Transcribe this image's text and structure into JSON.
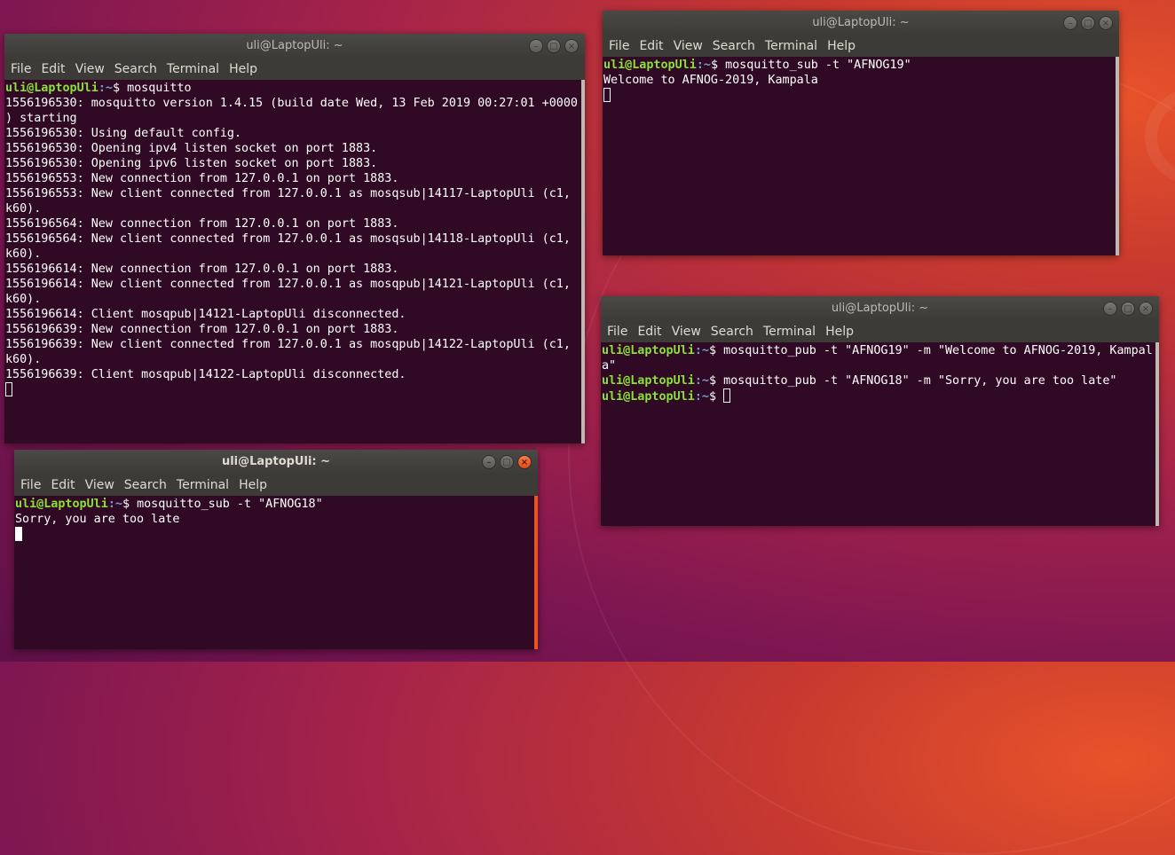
{
  "prompt": {
    "user": "uli@LaptopUli",
    "path": ":~",
    "symbol": "$ "
  },
  "windows": {
    "broker": {
      "title": "uli@LaptopUli: ~",
      "menu": [
        "File",
        "Edit",
        "View",
        "Search",
        "Terminal",
        "Help"
      ],
      "command": "mosquitto",
      "output": [
        "1556196530: mosquitto version 1.4.15 (build date Wed, 13 Feb 2019 00:27:01 +0000",
        ") starting",
        "1556196530: Using default config.",
        "1556196530: Opening ipv4 listen socket on port 1883.",
        "1556196530: Opening ipv6 listen socket on port 1883.",
        "1556196553: New connection from 127.0.0.1 on port 1883.",
        "1556196553: New client connected from 127.0.0.1 as mosqsub|14117-LaptopUli (c1,",
        "k60).",
        "1556196564: New connection from 127.0.0.1 on port 1883.",
        "1556196564: New client connected from 127.0.0.1 as mosqsub|14118-LaptopUli (c1,",
        "k60).",
        "1556196614: New connection from 127.0.0.1 on port 1883.",
        "1556196614: New client connected from 127.0.0.1 as mosqpub|14121-LaptopUli (c1,",
        "k60).",
        "1556196614: Client mosqpub|14121-LaptopUli disconnected.",
        "1556196639: New connection from 127.0.0.1 on port 1883.",
        "1556196639: New client connected from 127.0.0.1 as mosqpub|14122-LaptopUli (c1,",
        "k60).",
        "1556196639: Client mosqpub|14122-LaptopUli disconnected."
      ]
    },
    "sub19": {
      "title": "uli@LaptopUli: ~",
      "menu": [
        "File",
        "Edit",
        "View",
        "Search",
        "Terminal",
        "Help"
      ],
      "command": "mosquitto_sub -t \"AFNOG19\"",
      "output": [
        "Welcome to AFNOG-2019, Kampala"
      ]
    },
    "pub": {
      "title": "uli@LaptopUli: ~",
      "menu": [
        "File",
        "Edit",
        "View",
        "Search",
        "Terminal",
        "Help"
      ],
      "command1": "mosquitto_pub -t \"AFNOG19\" -m \"Welcome to AFNOG-2019, Kampal",
      "command1_wrap": "a\"",
      "command2": "mosquitto_pub -t \"AFNOG18\" -m \"Sorry, you are too late\""
    },
    "sub18": {
      "title": "uli@LaptopUli: ~",
      "menu": [
        "File",
        "Edit",
        "View",
        "Search",
        "Terminal",
        "Help"
      ],
      "command": "mosquitto_sub -t \"AFNOG18\"",
      "output": [
        "Sorry, you are too late"
      ]
    }
  },
  "colors": {
    "terminal_bg": "#300a24",
    "prompt_user": "#8ae234",
    "prompt_path": "#729fcf",
    "accent": "#e95420"
  }
}
